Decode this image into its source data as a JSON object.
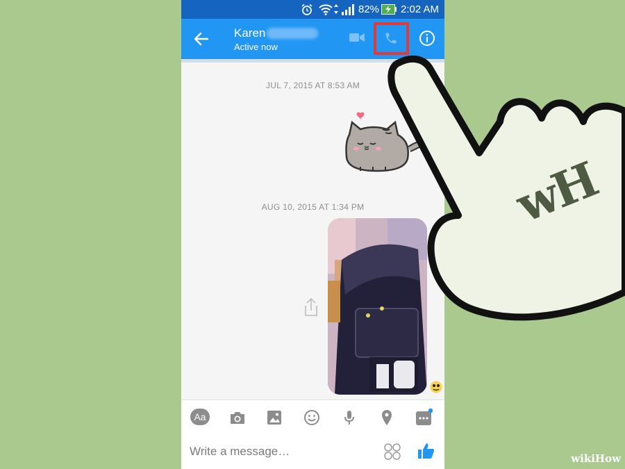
{
  "status_bar": {
    "battery": "82%",
    "time": "2:02 AM"
  },
  "header": {
    "contact_name": "Karen",
    "contact_status": "Active now",
    "back_icon": "arrow-left-icon",
    "video_icon": "video-camera-icon",
    "call_icon": "phone-icon",
    "info_icon": "info-icon"
  },
  "conversation": {
    "timestamps": [
      "JUL 7, 2015 AT 8:53 AM",
      "AUG 10, 2015 AT 1:34 PM"
    ],
    "sticker": "pusheen-cat-sticker",
    "photo": "backpack-photo"
  },
  "composer": {
    "icons": [
      "aa-icon",
      "camera-icon",
      "image-icon",
      "emoji-icon",
      "microphone-icon",
      "location-pin-icon",
      "more-icon"
    ],
    "aa_label": "Aa",
    "placeholder": "Write a message…"
  },
  "watermark": {
    "logo_text": "wH",
    "brand_prefix": "wiki",
    "brand_suffix": "How"
  },
  "colors": {
    "header_blue": "#2196f3",
    "status_bar_blue": "#1565c0",
    "highlight_red": "#e53935",
    "background_green": "#a9c98f"
  }
}
